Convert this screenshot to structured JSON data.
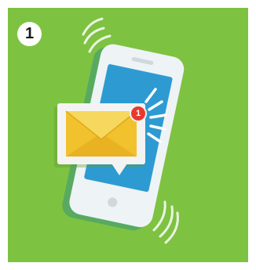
{
  "step": {
    "number": "1"
  },
  "notification": {
    "count": "1"
  },
  "colors": {
    "background": "#7ec242",
    "phone_body": "#eef3f5",
    "phone_screen": "#2d9bd2",
    "envelope": "#f2c12e",
    "envelope_flap": "#f7d85e",
    "badge": "#e8392d",
    "vibration_lines": "#ffffff"
  },
  "icons": [
    "smartphone-icon",
    "envelope-icon",
    "notification-badge",
    "vibration-waves"
  ]
}
